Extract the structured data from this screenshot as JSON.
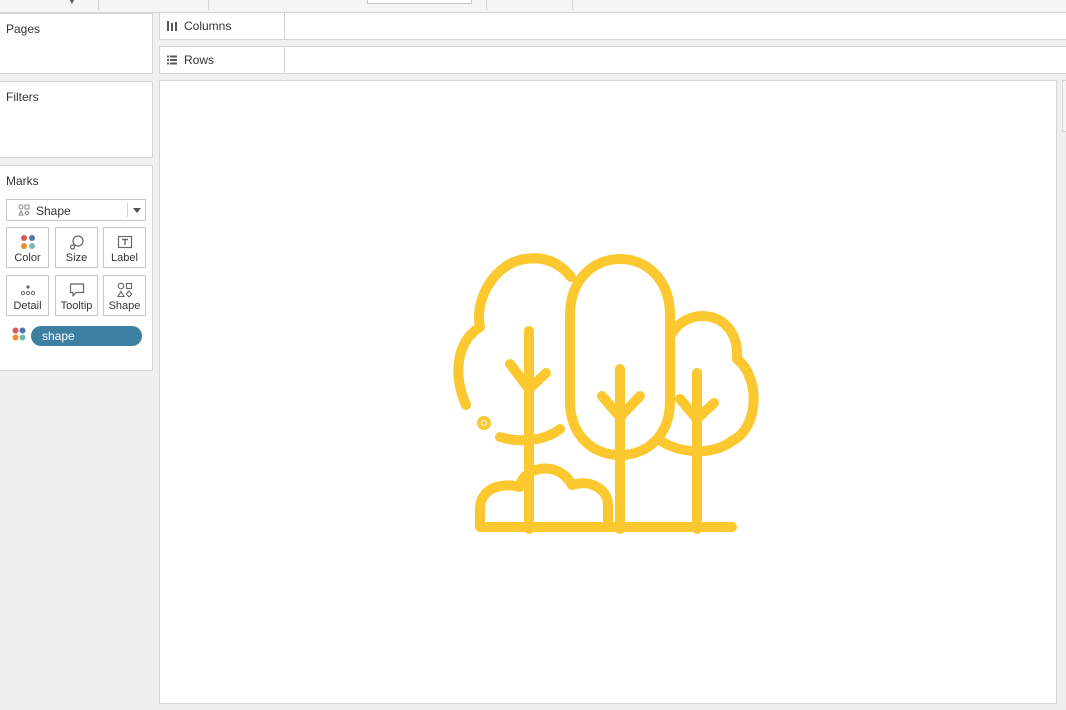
{
  "shelves": {
    "pages_title": "Pages",
    "filters_title": "Filters",
    "columns_label": "Columns",
    "rows_label": "Rows"
  },
  "marks": {
    "title": "Marks",
    "mark_type": "Shape",
    "buttons": [
      {
        "label": "Color",
        "icon": "color-dots-icon"
      },
      {
        "label": "Size",
        "icon": "size-icon"
      },
      {
        "label": "Label",
        "icon": "label-icon"
      },
      {
        "label": "Detail",
        "icon": "detail-icon"
      },
      {
        "label": "Tooltip",
        "icon": "tooltip-icon"
      },
      {
        "label": "Shape",
        "icon": "shape-icon"
      }
    ],
    "pill": {
      "label": "shape",
      "color": "#3c7fa0",
      "icon": "color-dots-icon"
    }
  },
  "view": {
    "mark_shape": "trees-icon",
    "mark_color": "#fbc830"
  }
}
